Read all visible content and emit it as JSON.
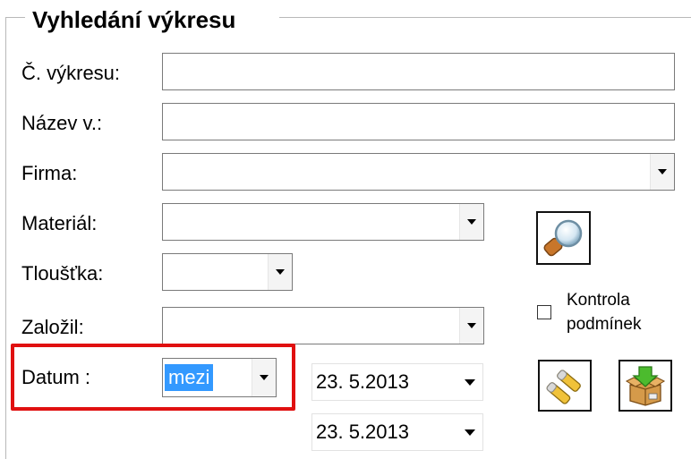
{
  "group": {
    "title": "Vyhledání výkresu"
  },
  "fields": {
    "drawing_number": {
      "label": "Č. výkresu:",
      "value": ""
    },
    "drawing_name": {
      "label": "Název v.:",
      "value": ""
    },
    "company": {
      "label": "Firma:",
      "value": ""
    },
    "material": {
      "label": "Materiál:",
      "value": ""
    },
    "thickness": {
      "label": "Tloušťka:",
      "value": ""
    },
    "created_by": {
      "label": "Založil:",
      "value": ""
    },
    "date": {
      "label": "Datum :",
      "mode": "mezi",
      "from": "23.  5.2013",
      "to": "23.  5.2013"
    }
  },
  "check_conditions": {
    "label_line1": "Kontrola",
    "label_line2": "podmínek",
    "checked": false
  },
  "icons": {
    "search": "magnifier-icon",
    "clear": "eraser-icon",
    "import": "box-with-green-arrow-icon"
  },
  "colors": {
    "highlight": "#e01010",
    "selection": "#3399ff"
  }
}
